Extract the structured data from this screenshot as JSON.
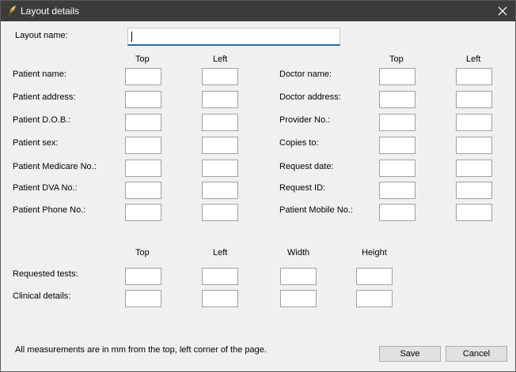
{
  "window": {
    "title": "Layout details"
  },
  "icons": {
    "app": "feather-app-icon",
    "close": "close-icon"
  },
  "layout_name": {
    "label": "Layout name:",
    "value": ""
  },
  "position_headers": {
    "top": "Top",
    "left": "Left"
  },
  "patient_fields": [
    {
      "label": "Patient name:",
      "top": "",
      "left": ""
    },
    {
      "label": "Patient address:",
      "top": "",
      "left": ""
    },
    {
      "label": "Patient D.O.B.:",
      "top": "",
      "left": ""
    },
    {
      "label": "Patient sex:",
      "top": "",
      "left": ""
    },
    {
      "label": "Patient Medicare No.:",
      "top": "",
      "left": ""
    },
    {
      "label": "Patient DVA No.:",
      "top": "",
      "left": ""
    },
    {
      "label": "Patient Phone No.:",
      "top": "",
      "left": ""
    }
  ],
  "doctor_fields": [
    {
      "label": "Doctor name:",
      "top": "",
      "left": ""
    },
    {
      "label": "Doctor address:",
      "top": "",
      "left": ""
    },
    {
      "label": "Provider No.:",
      "top": "",
      "left": ""
    },
    {
      "label": "Copies to:",
      "top": "",
      "left": ""
    },
    {
      "label": "Request date:",
      "top": "",
      "left": ""
    },
    {
      "label": "Request ID:",
      "top": "",
      "left": ""
    },
    {
      "label": "Patient Mobile No.:",
      "top": "",
      "left": ""
    }
  ],
  "area_headers": {
    "top": "Top",
    "left": "Left",
    "width": "Width",
    "height": "Height"
  },
  "area_fields": [
    {
      "label": "Requested tests:",
      "top": "",
      "left": "",
      "width": "",
      "height": ""
    },
    {
      "label": "Clinical details:",
      "top": "",
      "left": "",
      "width": "",
      "height": ""
    }
  ],
  "footer": {
    "note": "All measurements are in mm from the top, left corner of the page.",
    "save_label": "Save",
    "cancel_label": "Cancel"
  }
}
